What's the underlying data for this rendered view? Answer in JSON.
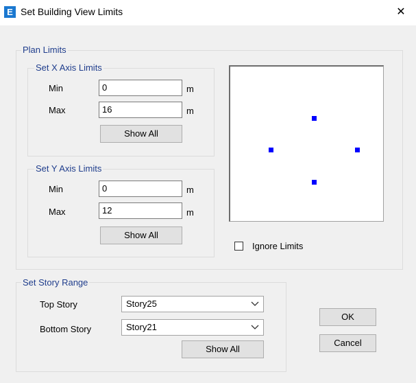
{
  "window": {
    "title": "Set Building View Limits",
    "icon_letter": "E",
    "close_glyph": "✕"
  },
  "plan_limits": {
    "legend": "Plan Limits",
    "x_axis": {
      "legend": "Set X Axis Limits",
      "min_label": "Min",
      "min_value": "0",
      "max_label": "Max",
      "max_value": "16",
      "unit": "m",
      "show_all_label": "Show All"
    },
    "y_axis": {
      "legend": "Set Y Axis Limits",
      "min_label": "Min",
      "min_value": "0",
      "max_label": "Max",
      "max_value": "12",
      "unit": "m",
      "show_all_label": "Show All"
    },
    "ignore_limits_label": "Ignore Limits",
    "ignore_limits_checked": false,
    "marker_color": "#0000ff"
  },
  "story_range": {
    "legend": "Set Story Range",
    "top_label": "Top Story",
    "top_value": "Story25",
    "bottom_label": "Bottom Story",
    "bottom_value": "Story21",
    "show_all_label": "Show All"
  },
  "buttons": {
    "ok_label": "OK",
    "cancel_label": "Cancel"
  }
}
